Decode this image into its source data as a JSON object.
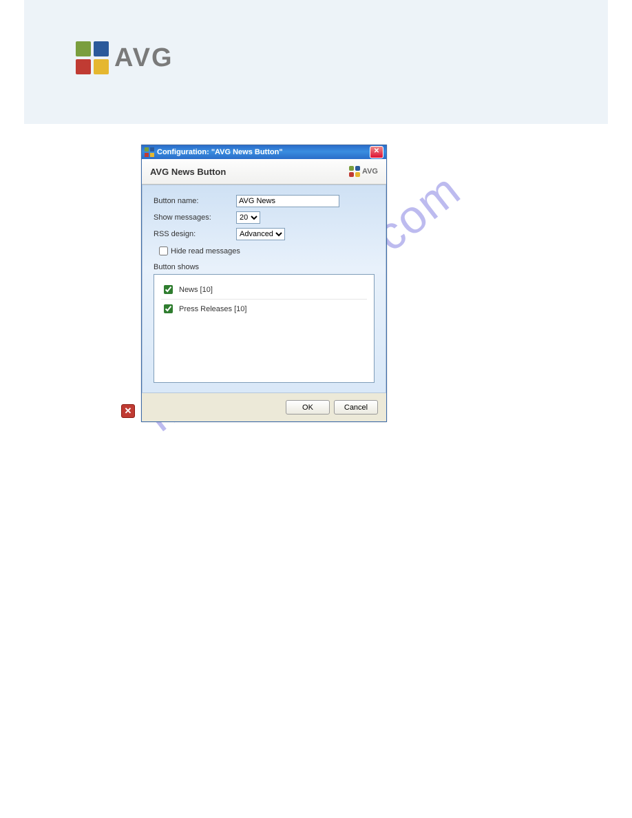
{
  "brand": "AVG",
  "dialog": {
    "title": "Configuration: \"AVG News Button\"",
    "subtitle": "AVG News Button",
    "labels": {
      "button_name": "Button name:",
      "show_messages": "Show messages:",
      "rss_design": "RSS design:",
      "hide_read": "Hide read messages",
      "button_shows": "Button shows"
    },
    "values": {
      "button_name": "AVG News",
      "show_messages": "20",
      "rss_design": "Advanced"
    },
    "feeds": [
      {
        "label": "News [10]",
        "checked": true
      },
      {
        "label": "Press Releases [10]",
        "checked": true
      }
    ],
    "buttons": {
      "ok": "OK",
      "cancel": "Cancel"
    }
  },
  "watermark": "manualshive.com"
}
